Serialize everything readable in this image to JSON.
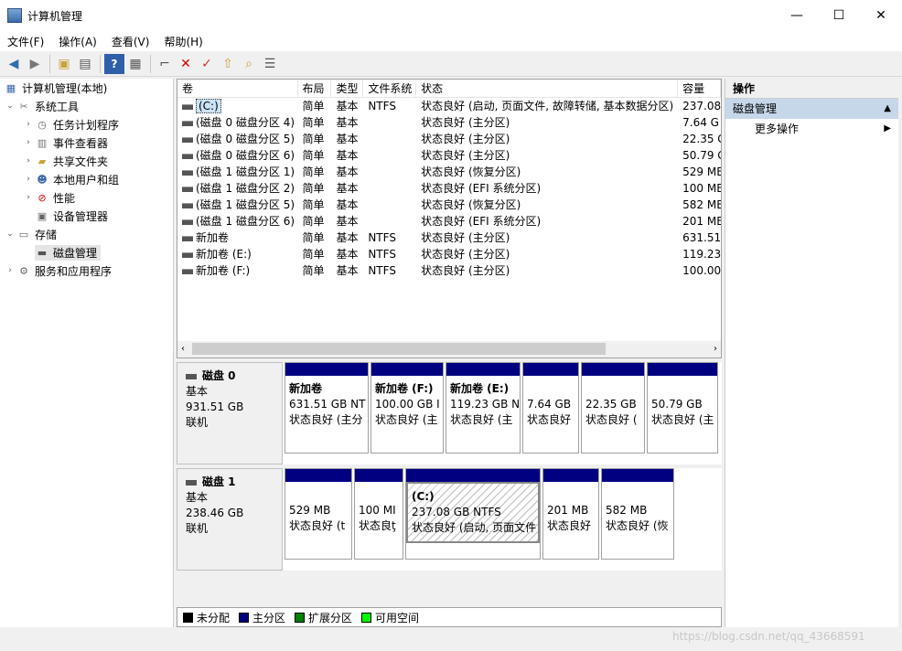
{
  "window": {
    "title": "计算机管理",
    "min": "—",
    "max": "☐",
    "close": "✕"
  },
  "menu": [
    "文件(F)",
    "操作(A)",
    "查看(V)",
    "帮助(H)"
  ],
  "toolbar": [
    "back-arrow-icon",
    "forward-arrow-icon",
    "up-folder-icon",
    "show-hide-tree-icon",
    "help-icon",
    "properties-icon",
    "connect-icon",
    "delete-icon",
    "check-icon",
    "import-icon",
    "search-icon",
    "list-icon"
  ],
  "tree": {
    "root": "计算机管理(本地)",
    "system_tools": "系统工具",
    "task_scheduler": "任务计划程序",
    "event_viewer": "事件查看器",
    "shared_folders": "共享文件夹",
    "local_users": "本地用户和组",
    "performance": "性能",
    "device_manager": "设备管理器",
    "storage": "存储",
    "disk_management": "磁盘管理",
    "services_apps": "服务和应用程序"
  },
  "volumes": {
    "columns": [
      "卷",
      "布局",
      "类型",
      "文件系统",
      "状态",
      "容量"
    ],
    "rows": [
      [
        "(C:)",
        "简单",
        "基本",
        "NTFS",
        "状态良好 (启动, 页面文件, 故障转储, 基本数据分区)",
        "237.08"
      ],
      [
        "(磁盘 0 磁盘分区 4)",
        "简单",
        "基本",
        "",
        "状态良好 (主分区)",
        "7.64 G"
      ],
      [
        "(磁盘 0 磁盘分区 5)",
        "简单",
        "基本",
        "",
        "状态良好 (主分区)",
        "22.35 G"
      ],
      [
        "(磁盘 0 磁盘分区 6)",
        "简单",
        "基本",
        "",
        "状态良好 (主分区)",
        "50.79 G"
      ],
      [
        "(磁盘 1 磁盘分区 1)",
        "简单",
        "基本",
        "",
        "状态良好 (恢复分区)",
        "529 MB"
      ],
      [
        "(磁盘 1 磁盘分区 2)",
        "简单",
        "基本",
        "",
        "状态良好 (EFI 系统分区)",
        "100 MB"
      ],
      [
        "(磁盘 1 磁盘分区 5)",
        "简单",
        "基本",
        "",
        "状态良好 (恢复分区)",
        "582 MB"
      ],
      [
        "(磁盘 1 磁盘分区 6)",
        "简单",
        "基本",
        "",
        "状态良好 (EFI 系统分区)",
        "201 MB"
      ],
      [
        "新加卷",
        "简单",
        "基本",
        "NTFS",
        "状态良好 (主分区)",
        "631.51"
      ],
      [
        "新加卷 (E:)",
        "简单",
        "基本",
        "NTFS",
        "状态良好 (主分区)",
        "119.23"
      ],
      [
        "新加卷 (F:)",
        "简单",
        "基本",
        "NTFS",
        "状态良好 (主分区)",
        "100.00"
      ]
    ]
  },
  "disks": [
    {
      "name": "磁盘 0",
      "type": "基本",
      "size": "931.51 GB",
      "status": "联机",
      "partitions": [
        [
          "新加卷",
          "631.51 GB NT",
          "状态良好 (主分"
        ],
        [
          "新加卷 (F:)",
          "100.00 GB I",
          "状态良好 (主"
        ],
        [
          "新加卷 (E:)",
          "119.23 GB N",
          "状态良好 (主"
        ],
        [
          "",
          "7.64 GB",
          "状态良好"
        ],
        [
          "",
          "22.35 GB",
          "状态良好 ("
        ],
        [
          "",
          "50.79 GB",
          "状态良好 (主"
        ]
      ]
    },
    {
      "name": "磁盘 1",
      "type": "基本",
      "size": "238.46 GB",
      "status": "联机",
      "partitions": [
        [
          "",
          "529 MB",
          "状态良好 (t"
        ],
        [
          "",
          "100 MI",
          "状态良ţ"
        ],
        [
          "(C:)",
          "237.08 GB NTFS",
          "状态良好 (启动, 页面文件"
        ],
        [
          "",
          "201 MB",
          "状态良好"
        ],
        [
          "",
          "582 MB",
          "状态良好 (恢"
        ]
      ]
    }
  ],
  "legend": [
    {
      "label": "未分配",
      "color": "#000000"
    },
    {
      "label": "主分区",
      "color": "#000080"
    },
    {
      "label": "扩展分区",
      "color": "#008000"
    },
    {
      "label": "可用空间",
      "color": "#00ff00"
    }
  ],
  "actions": {
    "header": "操作",
    "section": "磁盘管理",
    "more": "更多操作"
  },
  "watermark": "https://blog.csdn.net/qq_43668591"
}
